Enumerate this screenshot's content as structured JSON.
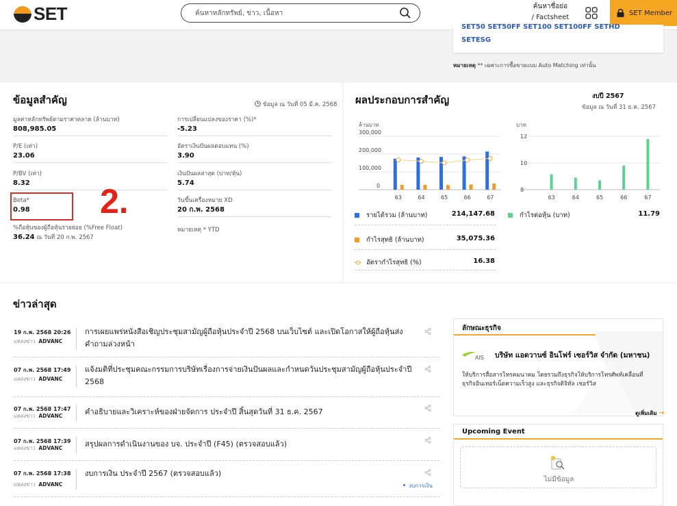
{
  "header": {
    "logo_text": "SET",
    "search_placeholder": "ค้นหาหลักทรัพย์, ข่าว, เนื้อหา",
    "factsheet_line1": "ค้นหาชื่อย่อ",
    "factsheet_line2": "/ Factsheet",
    "member_label": "SET Member"
  },
  "top_card": {
    "cut_text": "SET50   SET50FF   SET100   SET100FF   SETHD",
    "link": "SETESG",
    "remark_label": "หมายเหตุ",
    "remark_text": " ** เฉพาะการซื้อขายแบบ Auto Matching เท่านั้น"
  },
  "key_data": {
    "title": "ข้อมูลสำคัญ",
    "as_of": "ข้อมูล ณ วันที่ 05 มี.ค. 2568",
    "items": [
      {
        "label": "มูลค่าหลักทรัพย์ตามราคาตลาด (ล้านบาท)",
        "value": "808,985.05"
      },
      {
        "label": "การเปลี่ยนแปลงของราคา (%)*",
        "value": "-5.23"
      },
      {
        "label": "P/E (เท่า)",
        "value": "23.06"
      },
      {
        "label": "อัตราเงินปันผลตอบแทน (%)",
        "value": "3.90"
      },
      {
        "label": "P/BV (เท่า)",
        "value": "8.32"
      },
      {
        "label": "เงินปันผลล่าสุด (บาท/หุ้น)",
        "value": "5.74"
      },
      {
        "label": "Beta*",
        "value": "0.98"
      },
      {
        "label": "วันขึ้นเครื่องหมาย XD",
        "value": "20 ก.พ. 2568"
      },
      {
        "label": "%ถือหุ้นของผู้ถือหุ้นรายย่อย (%Free Float)",
        "value": "36.24",
        "note": " ณ วันที่ 20 ก.พ. 2567"
      },
      {
        "label": "หมายเหตุ  * YTD",
        "value": ""
      }
    ],
    "annotation_number": "2."
  },
  "performance": {
    "title": "ผลประกอบการสำคัญ",
    "period": "งบปี 2567",
    "as_of": "ข้อมูล ณ วันที่ 31 ธ.ค. 2567",
    "legend": [
      {
        "label": "รายได้รวม (ล้านบาท)",
        "value": "214,147.68",
        "color": "#2f6fe0"
      },
      {
        "label": "กำไรต่อหุ้น (บาท)",
        "value": "11.79",
        "color": "#5fd18f"
      },
      {
        "label": "กำไรสุทธิ (ล้านบาท)",
        "value": "35,075.36",
        "color": "#f59a2a"
      },
      {
        "label": "อัตรากำไรสุทธิ (%)",
        "value": "16.38",
        "color": "#f5a623"
      }
    ]
  },
  "chart_data": [
    {
      "type": "bar",
      "ylabel": "ล้านบาท",
      "ylim": [
        0,
        300000
      ],
      "yticks": [
        "300,000",
        "200,000",
        "100,000",
        "0"
      ],
      "categories": [
        "63",
        "64",
        "65",
        "66",
        "67"
      ],
      "series": [
        {
          "name": "รายได้รวม (ล้านบาท)",
          "values": [
            174000,
            181000,
            184000,
            187000,
            214000
          ]
        },
        {
          "name": "กำไรสุทธิ (ล้านบาท)",
          "values": [
            27000,
            27000,
            26000,
            29000,
            35000
          ]
        },
        {
          "name": "อัตรากำไรสุทธิ (%)",
          "values": [
            15.6,
            14.9,
            14.1,
            15.5,
            16.38
          ]
        }
      ]
    },
    {
      "type": "bar",
      "ylabel": "บาท",
      "ylim": [
        8,
        12
      ],
      "yticks": [
        "12",
        "10",
        "8"
      ],
      "categories": [
        "63",
        "64",
        "65",
        "66",
        "67"
      ],
      "series": [
        {
          "name": "กำไรต่อหุ้น (บาท)",
          "values": [
            9.15,
            8.9,
            8.7,
            9.8,
            11.79
          ]
        }
      ]
    }
  ],
  "news": {
    "title": "ข่าวล่าสุด",
    "items": [
      {
        "date": "19 ก.พ. 2568  20:26",
        "src_label": "แหล่งข่าว",
        "src": "ADVANC",
        "headline": "การเผยแพร่หนังสือเชิญประชุมสามัญผู้ถือหุ้นประจำปี 2568 บนเว็บไซต์ และเปิดโอกาสให้ผู้ถือหุ้นส่งคำถามล่วงหน้า"
      },
      {
        "date": "07 ก.พ. 2568  17:49",
        "src_label": "แหล่งข่าว",
        "src": "ADVANC",
        "headline": "แจ้งมติที่ประชุมคณะกรรมการบริษัทเรื่องการจ่ายเงินปันผลและกำหนดวันประชุมสามัญผู้ถือหุ้นประจำปี 2568"
      },
      {
        "date": "07 ก.พ. 2568  17:47",
        "src_label": "แหล่งข่าว",
        "src": "ADVANC",
        "headline": "คำอธิบายและวิเคราะห์ของฝ่ายจัดการ ประจำปี สิ้นสุดวันที่ 31 ธ.ค. 2567"
      },
      {
        "date": "07 ก.พ. 2568  17:39",
        "src_label": "แหล่งข่าว",
        "src": "ADVANC",
        "headline": "สรุปผลการดำเนินงานของ บจ. ประจำปี (F45) (ตรวจสอบแล้ว)"
      },
      {
        "date": "07 ก.พ. 2568  17:38",
        "src_label": "แหล่งข่าว",
        "src": "ADVANC",
        "headline": "งบการเงิน ประจำปี 2567 (ตรวจสอบแล้ว)",
        "tag": "งบการเงิน"
      }
    ]
  },
  "business": {
    "title": "ลักษณะธุรกิจ",
    "logo_text": "AIS",
    "company": "บริษัท แอดวานซ์ อินโฟร์ เซอร์วิส จำกัด (มหาชน)",
    "description": "ให้บริการสื่อสารโทรคมนาคม โดยรวมถึงธุรกิจให้บริการโทรศัพท์เคลื่อนที่ ธุรกิจอินเทอร์เน็ตความเร็วสูง และธุรกิจดิจิทัล เซอร์วิส",
    "more": "ดูเพิ่มเติม",
    "more_arrow": "→"
  },
  "events": {
    "title": "Upcoming Event",
    "empty": "ไม่มีข้อมูล"
  }
}
